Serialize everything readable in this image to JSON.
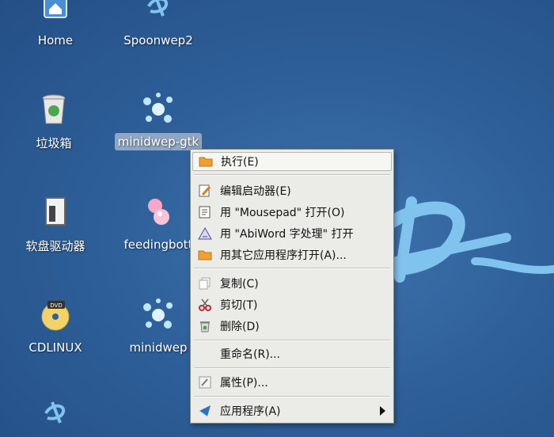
{
  "desktop": {
    "icons": [
      {
        "label": "Home"
      },
      {
        "label": "Spoonwep2"
      },
      {
        "label": "垃圾箱"
      },
      {
        "label": "minidwep-gtk"
      },
      {
        "label": "软盘驱动器"
      },
      {
        "label": "feedingbott"
      },
      {
        "label": "CDLINUX"
      },
      {
        "label": "minidwep"
      }
    ]
  },
  "menu": {
    "items": [
      {
        "label": "执行(E)",
        "icon": "folder-orange-icon"
      },
      {
        "label": "编辑启动器(E)",
        "icon": "edit-launcher-icon"
      },
      {
        "label": "用 \"Mousepad\" 打开(O)",
        "icon": "text-editor-icon"
      },
      {
        "label": "用 \"AbiWord 字处理\" 打开",
        "icon": "abiword-icon"
      },
      {
        "label": "用其它应用程序打开(A)...",
        "icon": "folder-orange-icon"
      },
      {
        "label": "复制(C)",
        "icon": "copy-icon"
      },
      {
        "label": "剪切(T)",
        "icon": "scissors-icon"
      },
      {
        "label": "删除(D)",
        "icon": "trash-icon"
      },
      {
        "label": "重命名(R)..."
      },
      {
        "label": "属性(P)...",
        "icon": "properties-icon"
      },
      {
        "label": "应用程序(A)",
        "icon": "applications-icon"
      }
    ]
  },
  "colors": {
    "desktop_bg": "#2f609a",
    "menu_bg": "#ebebe7",
    "selection": "#a0b4cd",
    "logo": "#7fc3ee"
  }
}
